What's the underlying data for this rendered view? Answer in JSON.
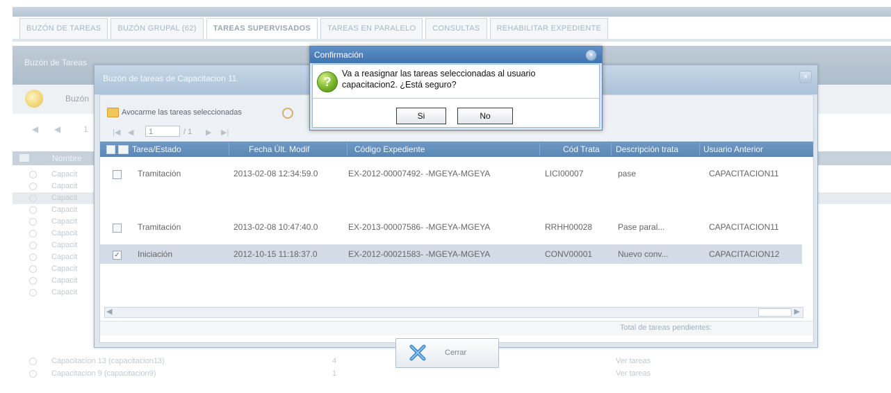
{
  "tabs": [
    "BUZÓN DE TAREAS",
    "BUZÓN GRUPAL (62)",
    "TAREAS SUPERVISADOS",
    "TAREAS EN PARALELO",
    "CONSULTAS",
    "REHABILITAR EXPEDIENTE"
  ],
  "active_tab_index": 2,
  "base": {
    "section_title": "Buzón de Tareas",
    "sub_title": "Buzón",
    "pager_text": "1",
    "grid_header": "Nombre",
    "rows": [
      {
        "name": "Capacit",
        "count": "",
        "link": ""
      },
      {
        "name": "Capacit",
        "count": "",
        "link": ""
      },
      {
        "name": "Capacit",
        "count": "",
        "link": ""
      },
      {
        "name": "Capacit",
        "count": "",
        "link": ""
      },
      {
        "name": "Capacit",
        "count": "",
        "link": ""
      },
      {
        "name": "Capacit",
        "count": "",
        "link": ""
      },
      {
        "name": "Capacit",
        "count": "",
        "link": ""
      },
      {
        "name": "Capacit",
        "count": "",
        "link": ""
      },
      {
        "name": "Capacit",
        "count": "",
        "link": ""
      },
      {
        "name": "Capacit",
        "count": "",
        "link": ""
      },
      {
        "name": "Capacit",
        "count": "",
        "link": ""
      },
      {
        "name": "Capacitacion 13 (capacitacion13)",
        "count": "4",
        "link": "Ver tareas"
      },
      {
        "name": "Capacitacion 9 (capacitacion9)",
        "count": "1",
        "link": "Ver tareas"
      }
    ]
  },
  "inner_dialog": {
    "title": "Buzón de tareas de Capacitacion 11",
    "close_glyph": "×",
    "toolbar": {
      "avocarme_label": "Avocarme las tareas seleccionadas"
    },
    "pager": {
      "page": "1",
      "of": "/ 1"
    },
    "columns": [
      "Tarea/Estado",
      "Fecha Últ. Modif",
      "Código Expediente",
      "Cód Trata",
      "Descripción trata",
      "Usuario Anterior"
    ],
    "rows": [
      {
        "checked": "",
        "tarea": "Tramitación",
        "fecha": "2013-02-08 12:34:59.0",
        "codigo": "EX-2012-00007492- -MGEYA-MGEYA",
        "trata": "LICI00007",
        "desc": "pase",
        "usuario": "CAPACITACION11"
      },
      {
        "checked": "",
        "tarea": "Tramitación",
        "fecha": "2013-02-08 10:47:40.0",
        "codigo": "EX-2013-00007586- -MGEYA-MGEYA",
        "trata": "RRHH00028",
        "desc": "Pase paral...",
        "usuario": "CAPACITACION11"
      },
      {
        "checked": "✓",
        "tarea": "Iniciación",
        "fecha": "2012-10-15 11:18:37.0",
        "codigo": "EX-2012-00021583- -MGEYA-MGEYA",
        "trata": "CONV00001",
        "desc": "Nuevo conv...",
        "usuario": "CAPACITACION12"
      }
    ],
    "total_label": "Total de tareas pendientes:",
    "close_button": "Cerrar"
  },
  "confirm": {
    "title": "Confirmación",
    "icon_glyph": "?",
    "close_glyph": "×",
    "message": "Va a reasignar las tareas seleccionadas al usuario capacitacion2. ¿Está seguro?",
    "yes": "Si",
    "no": "No"
  },
  "colors": {
    "header_blue": "#5a86b4",
    "dialog_title_blue": "#3f74b0",
    "selected_row": "#d2dbe6"
  }
}
